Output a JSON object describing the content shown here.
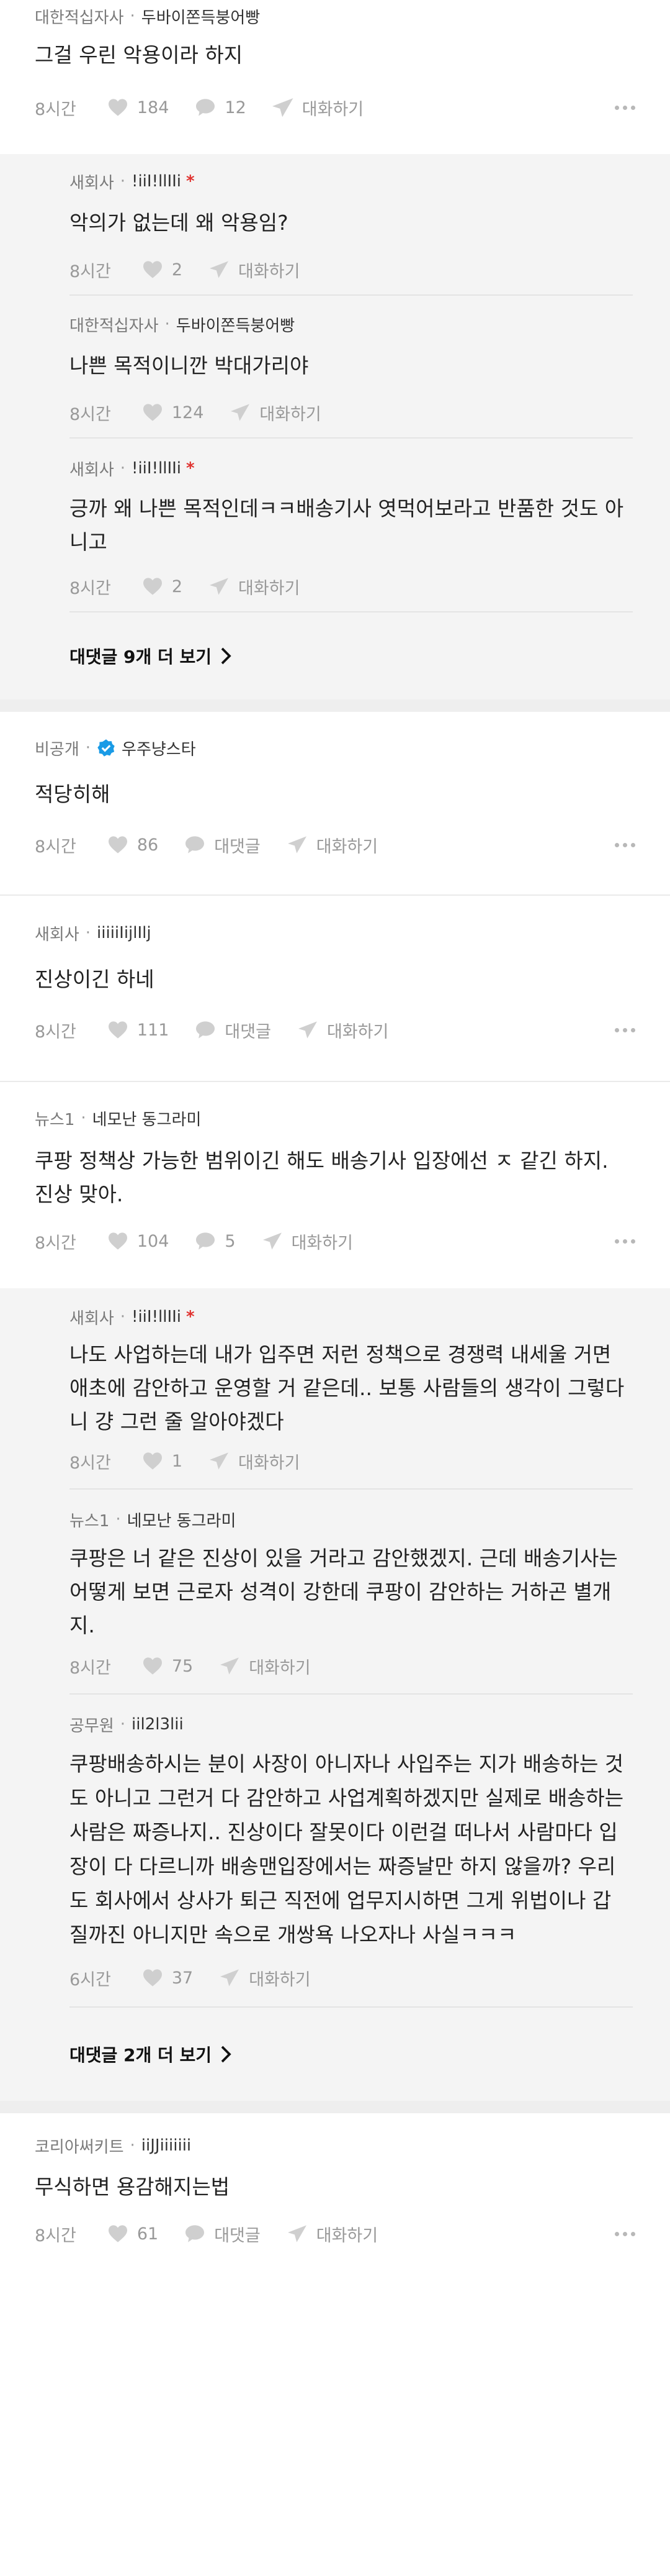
{
  "comments": [
    {
      "company": "대한적십자사",
      "nickname": "두바이쫀득붕어빵",
      "text": "그걸 우린 악용이라 하지",
      "time": "8시간",
      "likes": "184",
      "comments": "12",
      "reply_label": "대화하기",
      "replies": [
        {
          "company": "새회사",
          "nickname": "!iiI!llIIi",
          "author_mark": "*",
          "text": "악의가 없는데 왜 악용임?",
          "time": "8시간",
          "likes": "2",
          "reply_label": "대화하기"
        },
        {
          "company": "대한적십자사",
          "nickname": "두바이쫀득붕어빵",
          "text": "나쁜 목적이니깐 박대가리야",
          "time": "8시간",
          "likes": "124",
          "reply_label": "대화하기"
        },
        {
          "company": "새회사",
          "nickname": "!iiI!llIIi",
          "author_mark": "*",
          "text": "긍까 왜 나쁜 목적인데ㅋㅋ배송기사 엿먹어보라고 반품한 것도 아니고",
          "time": "8시간",
          "likes": "2",
          "reply_label": "대화하기"
        }
      ],
      "more_replies": "대댓글 9개 더 보기"
    },
    {
      "company": "비공개",
      "nickname": "우주냥스타",
      "text": "적당히해",
      "time": "8시간",
      "likes": "86",
      "comment_label": "대댓글",
      "reply_label": "대화하기"
    },
    {
      "company": "새회사",
      "nickname": "iiiiiIijlIlj",
      "text": "진상이긴 하네",
      "time": "8시간",
      "likes": "111",
      "comment_label": "대댓글",
      "reply_label": "대화하기"
    },
    {
      "company": "뉴스1",
      "nickname": "네모난 동그라미",
      "text": "쿠팡 정책상 가능한 범위이긴 해도 배송기사 입장에선 ㅈ 같긴 하지. 진상 맞아.",
      "time": "8시간",
      "likes": "104",
      "comments": "5",
      "reply_label": "대화하기",
      "replies": [
        {
          "company": "새회사",
          "nickname": "!iiI!llIIi",
          "author_mark": "*",
          "text": "나도 사업하는데 내가 입주면 저런 정책으로 경쟁력 내세울 거면 애초에 감안하고 운영할 거 같은데.. 보통 사람들의 생각이 그렇다니 걍 그런 줄 알아야겠다",
          "time": "8시간",
          "likes": "1",
          "reply_label": "대화하기"
        },
        {
          "company": "뉴스1",
          "nickname": "네모난 동그라미",
          "text": "쿠팡은 너 같은 진상이 있을 거라고 감안했겠지. 근데 배송기사는 어떻게 보면 근로자 성격이 강한데 쿠팡이 감안하는 거하곤 별개지.",
          "time": "8시간",
          "likes": "75",
          "reply_label": "대화하기"
        },
        {
          "company": "공무원",
          "nickname": "iil2l3lii",
          "text": "쿠팡배송하시는 분이 사장이 아니자나 사입주는 지가 배송하는 것도 아니고 그런거 다 감안하고 사업계획하겠지만 실제로 배송하는 사람은 짜증나지.. 진상이다 잘못이다 이런걸 떠나서 사람마다 입장이 다 다르니까 배송맨입장에서는 짜증날만 하지 않을까? 우리도 회사에서 상사가 퇴근 직전에 업무지시하면 그게 위법이나 갑질까진 아니지만 속으로 개쌍욕 나오자나 사실ㅋㅋㅋ",
          "time": "6시간",
          "likes": "37",
          "reply_label": "대화하기"
        }
      ],
      "more_replies": "대댓글 2개 더 보기"
    },
    {
      "company": "코리아써키트",
      "nickname": "iiJJiiiiiii",
      "text": "무식하면 용감해지는법",
      "time": "8시간",
      "likes": "61",
      "comment_label": "대댓글",
      "reply_label": "대화하기"
    }
  ],
  "colors": {
    "reply_bg": "#f4f4f4",
    "mark": "#e0322f",
    "verified": "#1a9be6"
  },
  "icons": [
    "heart-icon",
    "comment-icon",
    "send-icon",
    "more-icon",
    "verified-icon",
    "chevron-right-icon"
  ]
}
